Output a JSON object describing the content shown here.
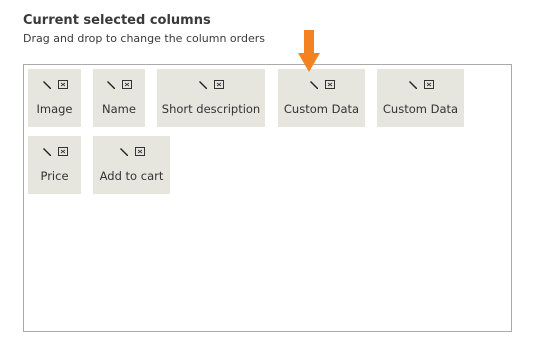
{
  "section": {
    "title": "Current selected columns",
    "subtitle": "Drag and drop to change the column orders"
  },
  "columns": [
    {
      "label": "Image"
    },
    {
      "label": "Name"
    },
    {
      "label": "Short description"
    },
    {
      "label": "Custom Data"
    },
    {
      "label": "Custom Data"
    },
    {
      "label": "Price"
    },
    {
      "label": "Add to cart"
    }
  ],
  "icons": {
    "edit": "pencil-icon",
    "remove": "remove-icon",
    "drop_indicator": "arrow-down-icon"
  },
  "colors": {
    "card_background": "#e6e6df",
    "indicator": "#f58220",
    "border": "#aaaaaa"
  }
}
